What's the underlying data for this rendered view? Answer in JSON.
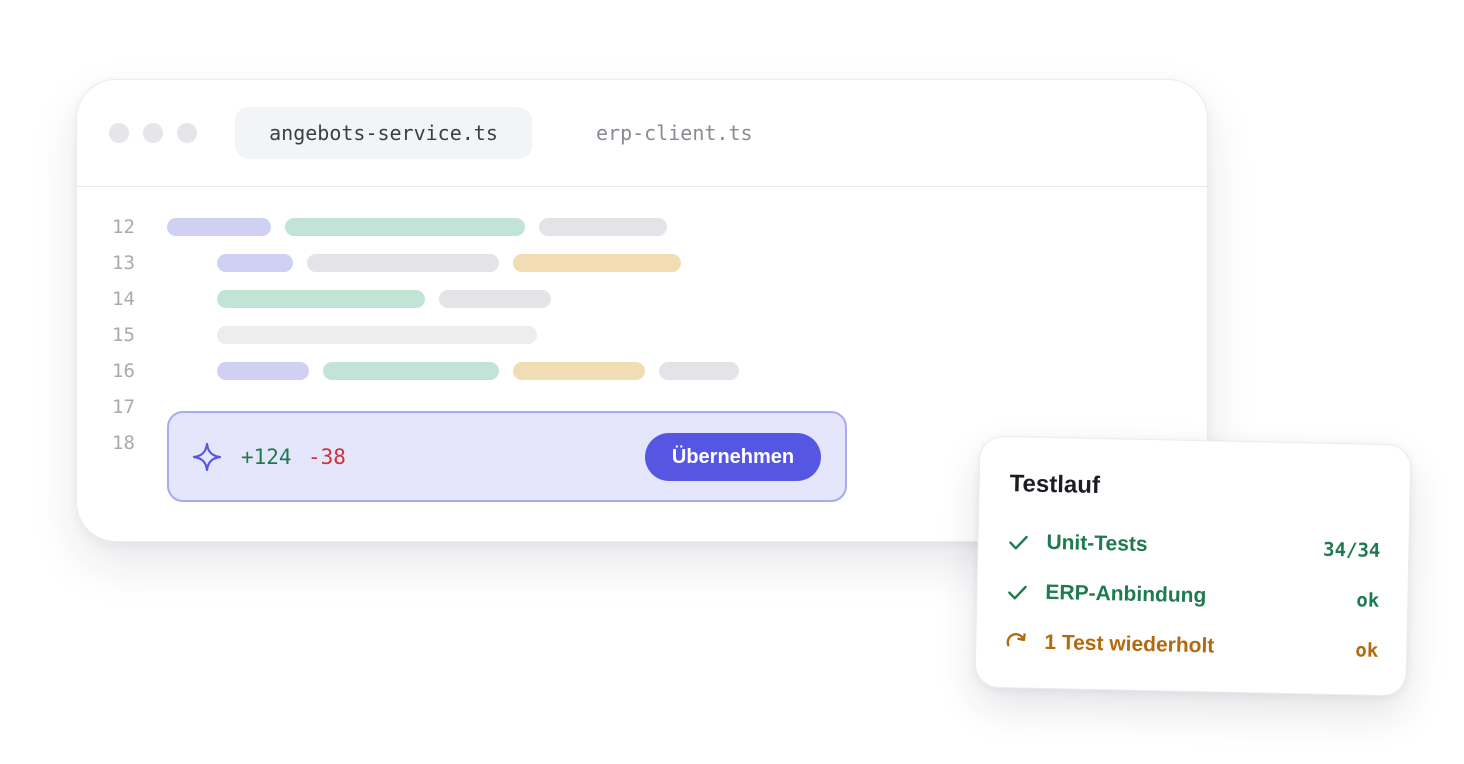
{
  "editor": {
    "tabs": [
      {
        "label": "angebots-service.ts",
        "active": true
      },
      {
        "label": "erp-client.ts",
        "active": false
      }
    ],
    "line_numbers": [
      "12",
      "13",
      "14",
      "15",
      "16",
      "17",
      "18"
    ],
    "suggestion": {
      "additions": "+124",
      "deletions": "-38",
      "apply_label": "Übernehmen",
      "icon": "sparkle-icon"
    }
  },
  "test_run": {
    "title": "Testlauf",
    "items": [
      {
        "label": "Unit-Tests",
        "value": "34/34",
        "status": "passed",
        "icon": "check-icon"
      },
      {
        "label": "ERP-Anbindung",
        "value": "ok",
        "status": "passed",
        "icon": "check-icon"
      },
      {
        "label": "1 Test wiederholt",
        "value": "ok",
        "status": "retried",
        "icon": "retry-icon"
      }
    ]
  },
  "colors": {
    "accent": "#5557e2",
    "addition": "#1f7a50",
    "deletion": "#c8343e",
    "warning": "#b4690e"
  }
}
